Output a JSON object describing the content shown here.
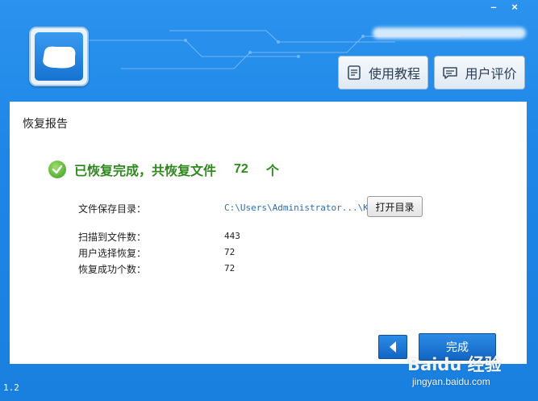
{
  "window": {
    "minimize_glyph": "–",
    "close_glyph": "×"
  },
  "header": {
    "tutorial_button": "使用教程",
    "tutorial_icon": "document-icon",
    "review_button": "用户评价",
    "review_icon": "comment-icon"
  },
  "report": {
    "section_title": "恢复报告",
    "success_message": "已恢复完成，共恢复文件",
    "recovered_count": "72",
    "count_unit": "个",
    "save_dir_label": "文件保存目录：",
    "save_dir_value": "C:\\Users\\Administrator...\\KDR",
    "open_dir_button": "打开目录",
    "scanned_label": "扫描到文件数：",
    "scanned_value": "443",
    "selected_label": "用户选择恢复：",
    "selected_value": "72",
    "success_label": "恢复成功个数：",
    "success_value": "72"
  },
  "footer": {
    "back_icon": "arrow-left-icon",
    "finish_button": "完成",
    "version": "1.2"
  },
  "watermark": {
    "brand": "Baidu 经验",
    "url": "jingyan.baidu.com"
  },
  "colors": {
    "window_blue": "#1a86e8",
    "success_green": "#2f8a1e",
    "path_blue": "#2a6db8"
  }
}
